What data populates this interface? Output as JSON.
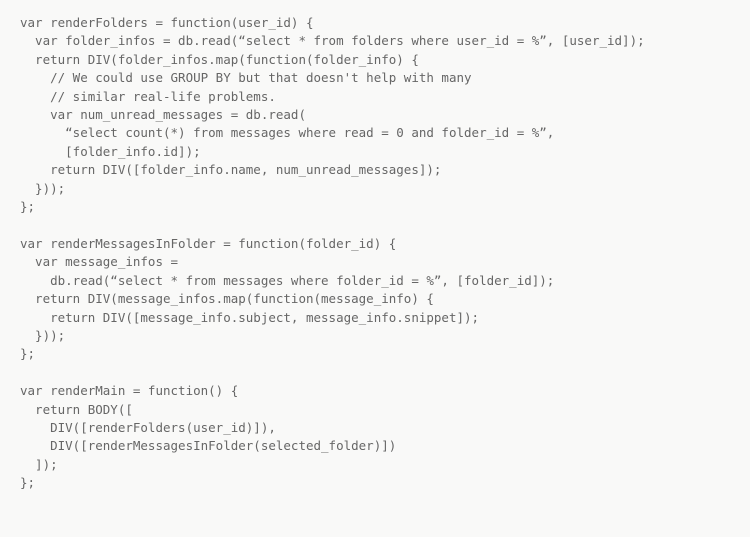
{
  "code": {
    "lines": [
      "var renderFolders = function(user_id) {",
      "  var folder_infos = db.read(“select * from folders where user_id = %”, [user_id]);",
      "  return DIV(folder_infos.map(function(folder_info) {",
      "    // We could use GROUP BY but that doesn't help with many",
      "    // similar real-life problems.",
      "    var num_unread_messages = db.read(",
      "      “select count(*) from messages where read = 0 and folder_id = %”,",
      "      [folder_info.id]);",
      "    return DIV([folder_info.name, num_unread_messages]);",
      "  }));",
      "};",
      "",
      "var renderMessagesInFolder = function(folder_id) {",
      "  var message_infos =",
      "    db.read(“select * from messages where folder_id = %”, [folder_id]);",
      "  return DIV(message_infos.map(function(message_info) {",
      "    return DIV([message_info.subject, message_info.snippet]);",
      "  }));",
      "};",
      "",
      "var renderMain = function() {",
      "  return BODY([",
      "    DIV([renderFolders(user_id)]),",
      "    DIV([renderMessagesInFolder(selected_folder)])",
      "  ]);",
      "};"
    ]
  }
}
